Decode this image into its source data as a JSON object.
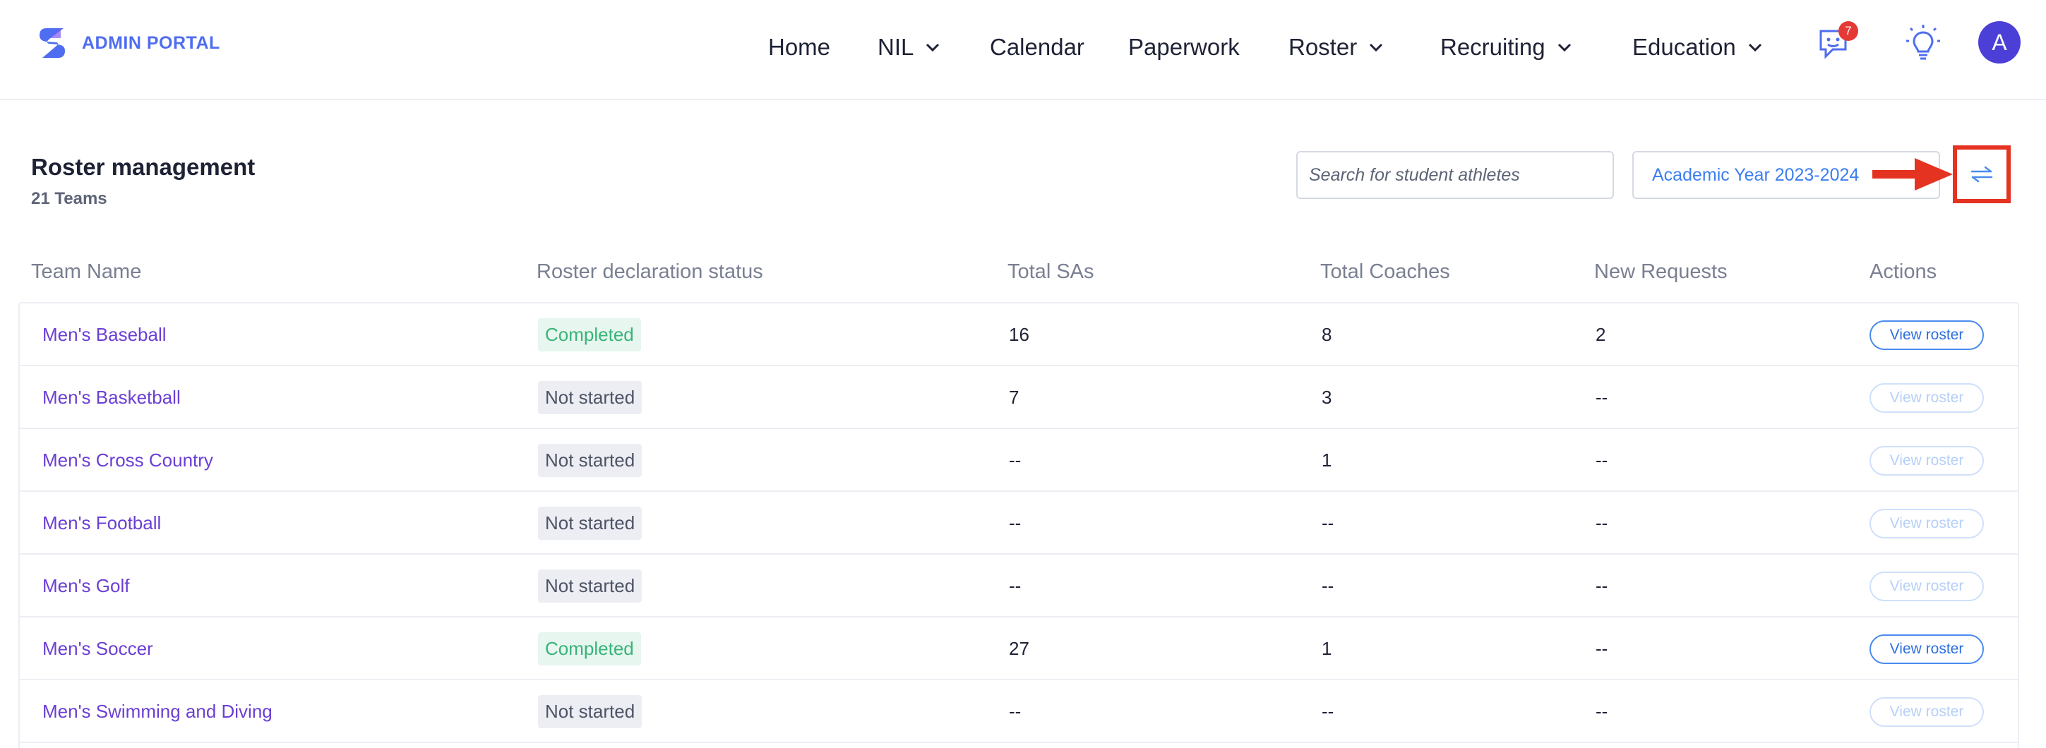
{
  "brand": {
    "name": "ADMIN PORTAL",
    "logo_icon": "brand-s-logo-icon"
  },
  "nav": {
    "home": "Home",
    "nil": "NIL",
    "calendar": "Calendar",
    "paperwork": "Paperwork",
    "roster": "Roster",
    "recruiting": "Recruiting",
    "education": "Education",
    "messages_badge": "7",
    "avatar_initial": "A"
  },
  "page": {
    "title": "Roster management",
    "subtitle": "21 Teams",
    "search_placeholder": "Search for student athletes",
    "year": "Academic Year 2023-2024",
    "swap_icon": "swap-arrows-icon"
  },
  "table": {
    "headers": [
      "Team Name",
      "Roster declaration status",
      "Total SAs",
      "Total Coaches",
      "New Requests",
      "Actions"
    ],
    "rows": [
      {
        "team": "Men's Baseball",
        "status": "Completed",
        "sas": "16",
        "coaches": "8",
        "requests": "2",
        "action": "View roster"
      },
      {
        "team": "Men's Basketball",
        "status": "Not started",
        "sas": "7",
        "coaches": "3",
        "requests": "--",
        "action": "View roster"
      },
      {
        "team": "Men's Cross Country",
        "status": "Not started",
        "sas": "--",
        "coaches": "1",
        "requests": "--",
        "action": "View roster"
      },
      {
        "team": "Men's Football",
        "status": "Not started",
        "sas": "--",
        "coaches": "--",
        "requests": "--",
        "action": "View roster"
      },
      {
        "team": "Men's Golf",
        "status": "Not started",
        "sas": "--",
        "coaches": "--",
        "requests": "--",
        "action": "View roster"
      },
      {
        "team": "Men's Soccer",
        "status": "Completed",
        "sas": "27",
        "coaches": "1",
        "requests": "--",
        "action": "View roster"
      },
      {
        "team": "Men's Swimming and Diving",
        "status": "Not started",
        "sas": "--",
        "coaches": "--",
        "requests": "--",
        "action": "View roster"
      }
    ]
  },
  "colors": {
    "accent": "#4f6df0",
    "team_link": "#6b3fd4",
    "completed_text": "#38b47a",
    "completed_bg": "#e7f6ee",
    "annotation_red": "#e53321"
  }
}
